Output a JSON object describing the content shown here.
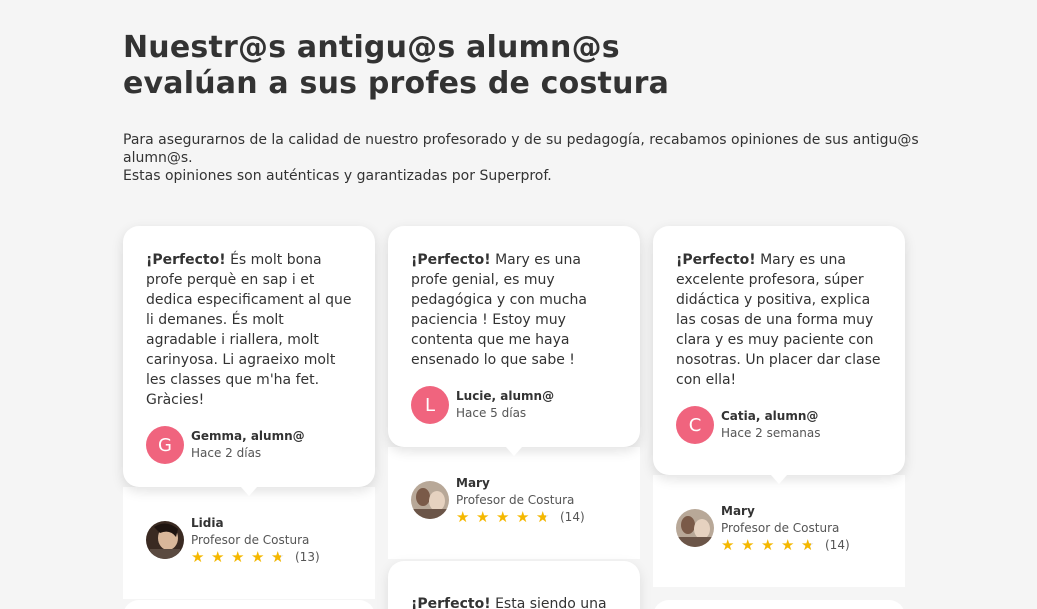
{
  "heading": {
    "line1": "Nuestr@s antigu@s alumn@s",
    "line2": "evalúan a sus profes de costura"
  },
  "intro": {
    "line1": "Para asegurarnos de la calidad de nuestro profesorado y de su pedagogía, recabamos opiniones de sus antigu@s",
    "line2": "alumn@s.",
    "line3": "Estas opiniones son auténticas y garantizadas por Superprof."
  },
  "columns": [
    {
      "review": {
        "lead": "¡Perfecto!",
        "text": " És molt bona profe perquè en sap i et dedica especificament al que li demanes. És molt agradable i riallera, molt carinyosa. Li agraeixo molt les classes que m'ha fet. Gràcies!",
        "initial": "G",
        "author": "Gemma, alumn@",
        "time": "Hace 2 días"
      },
      "teacher": {
        "name": "Lidia",
        "role": "Profesor de Costura",
        "rating": 4.5,
        "count": "(13)"
      }
    },
    {
      "review": {
        "lead": "¡Perfecto!",
        "text": " Mary es una profe genial, es muy pedagógica y con mucha paciencia ! Estoy muy contenta que me haya ensenado lo que sabe !",
        "initial": "L",
        "author": "Lucie, alumn@",
        "time": "Hace 5 días"
      },
      "teacher": {
        "name": "Mary",
        "role": "Profesor de Costura",
        "rating": 4.5,
        "count": "(14)"
      },
      "next_review": {
        "lead": "¡Perfecto!",
        "text": " Esta siendo una"
      }
    },
    {
      "review": {
        "lead": "¡Perfecto!",
        "text": " Mary es una excelente profesora, súper didáctica y positiva, explica las cosas de una forma muy clara y es muy paciente con nosotras. Un placer dar clase con ella!",
        "initial": "C",
        "author": "Catia, alumn@",
        "time": "Hace 2 semanas"
      },
      "teacher": {
        "name": "Mary",
        "role": "Profesor de Costura",
        "rating": 4.5,
        "count": "(14)"
      }
    }
  ],
  "colors": {
    "background": "#f5f5f5",
    "avatar_pink": "#f0647e",
    "star": "#f5b800"
  }
}
